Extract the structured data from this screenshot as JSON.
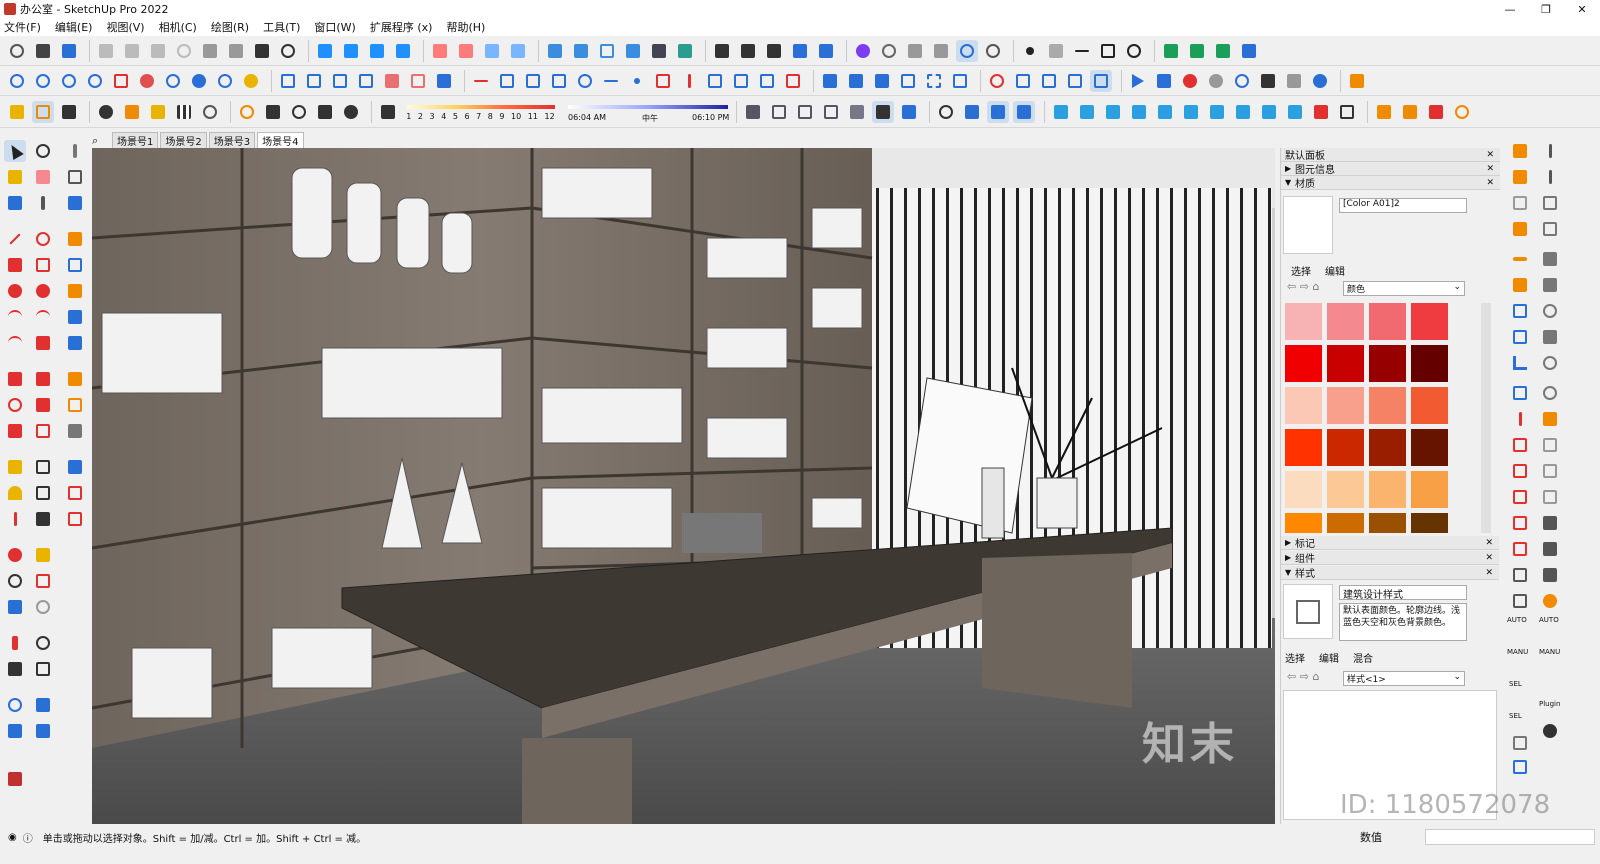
{
  "window": {
    "title": "办公室 - SketchUp Pro 2022",
    "minimize": "—",
    "restore": "❐",
    "close": "✕"
  },
  "menu": [
    "文件(F)",
    "编辑(E)",
    "视图(V)",
    "相机(C)",
    "绘图(R)",
    "工具(T)",
    "窗口(W)",
    "扩展程序 (x)",
    "帮助(H)"
  ],
  "shadow_bar": {
    "ticks": [
      "1",
      "2",
      "3",
      "4",
      "5",
      "6",
      "7",
      "8",
      "9",
      "10",
      "11",
      "12"
    ],
    "time_start": "06:04 AM",
    "time_mid": "中午",
    "time_end": "06:10 PM"
  },
  "scenes": {
    "search_icon": "search-icon",
    "tabs": [
      "场景号1",
      "场景号2",
      "场景号3",
      "场景号4"
    ],
    "active": 3
  },
  "panel": {
    "title": "默认面板",
    "entity_info": "图元信息",
    "materials": {
      "header": "材质",
      "name": "[Color A01]2",
      "tab_select": "选择",
      "tab_edit": "编辑",
      "library": "颜色",
      "colors": [
        "#f7b2b4",
        "#f48a8f",
        "#f16a6f",
        "#ee3c40",
        "#f00000",
        "#c80000",
        "#960000",
        "#640000",
        "#fac8b4",
        "#f8a08c",
        "#f58264",
        "#f25a32",
        "#ff3200",
        "#cc2800",
        "#991e00",
        "#661400",
        "#fcdcbe",
        "#fcc896",
        "#fab46e",
        "#f8a046",
        "#ff8800",
        "#cc6c00",
        "#995000",
        "#663400"
      ]
    },
    "tags": "标记",
    "components": "组件",
    "styles": {
      "header": "样式",
      "name": "建筑设计样式",
      "desc": "默认表面颜色。轮廓边线。浅蓝色天空和灰色背景颜色。",
      "tab_select": "选择",
      "tab_edit": "编辑",
      "tab_mix": "混合",
      "library": "样式<1>"
    }
  },
  "right_labels": {
    "auto1": "AUTO",
    "manu1": "MANU",
    "auto2": "AUTO",
    "manu2": "MANU",
    "sel1": "SEL",
    "sel2": "SEL",
    "plugin": "Plugin"
  },
  "watermark": {
    "logo": "知末",
    "id": "ID: 1180572078"
  },
  "status": {
    "hint": "单击或拖动以选择对象。Shift = 加/减。Ctrl = 加。Shift + Ctrl = 减。",
    "measure_label": "数值"
  }
}
